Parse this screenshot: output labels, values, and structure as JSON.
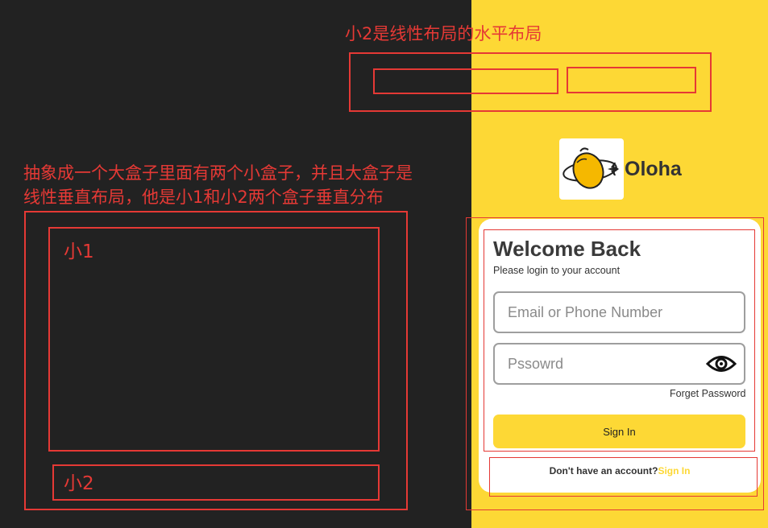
{
  "annotations": {
    "top_title": "小2是线性布局的水平布局",
    "desc_line1": "抽象成一个大盒子里面有两个小盒子，并且大盒子是",
    "desc_line2": "线性垂直布局，他是小1和小2两个盒子垂直分布",
    "box1_label": "小1",
    "box2_label": "小2"
  },
  "brand": {
    "name": "Oloha",
    "logo_icon": "lemon-plane-logo"
  },
  "login": {
    "title": "Welcome Back",
    "subtitle": "Please login to your account",
    "email_placeholder": "Email or Phone Number",
    "password_placeholder": "Pssowrd",
    "password_toggle_icon": "eye-icon",
    "forget_label": "Forget Password",
    "signin_label": "Sign In",
    "footer_text": "Don't have an account?",
    "footer_link": "Sign In"
  },
  "colors": {
    "background": "#222222",
    "accent": "#fdd835",
    "annotation": "#e53935"
  }
}
